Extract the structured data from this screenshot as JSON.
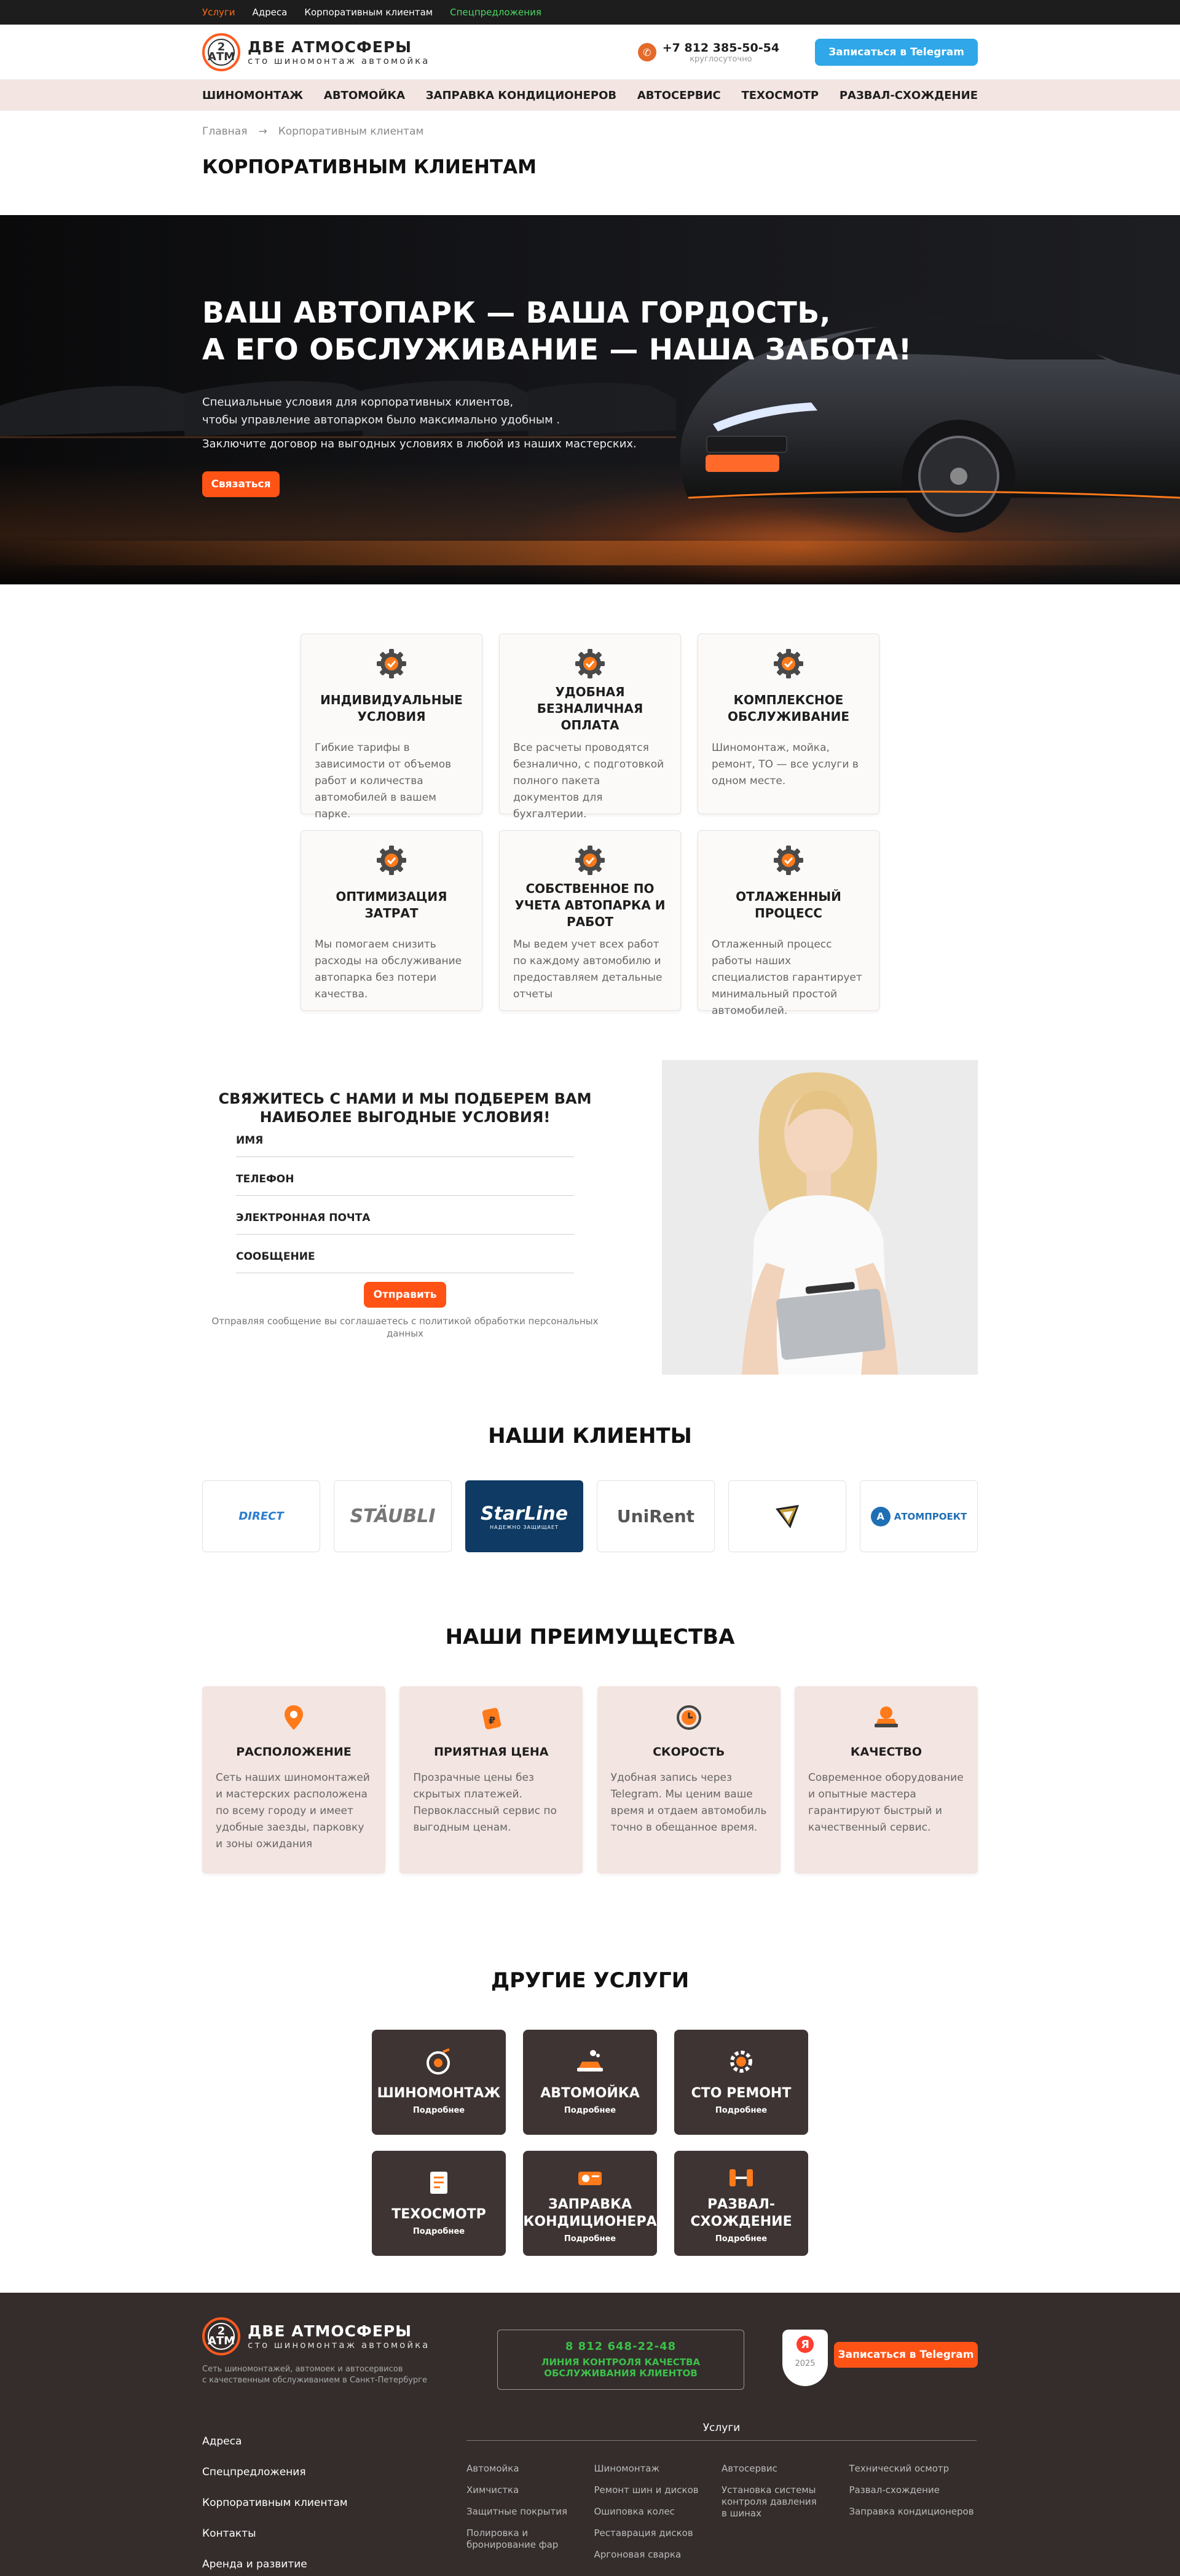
{
  "topbar": {
    "items": [
      "Услуги",
      "Адреса",
      "Корпоративным клиентам",
      "Спецпредложения"
    ]
  },
  "header": {
    "logo_badge": "2\nАТМ",
    "logo_title": "ДВЕ АТМОСФЕРЫ",
    "logo_subtitle": "сто шиномонтаж автомойка",
    "phone": "+7 812 385-50-54",
    "phone_note": "круглосуточно",
    "telegram_button": "Записаться в Telegram"
  },
  "nav": [
    "ШИНОМОНТАЖ",
    "АВТОМОЙКА",
    "ЗАПРАВКА КОНДИЦИОНЕРОВ",
    "АВТОСЕРВИС",
    "ТЕХОСМОТР",
    "РАЗВАЛ-СХОЖДЕНИЕ"
  ],
  "breadcrumb": {
    "home": "Главная",
    "sep": "→",
    "current": "Корпоративным клиентам"
  },
  "page_title": "КОРПОРАТИВНЫМ КЛИЕНТАМ",
  "hero": {
    "title_line1": "ВАШ АВТОПАРК — ВАША ГОРДОСТЬ,",
    "title_line2": "А ЕГО ОБСЛУЖИВАНИЕ — НАША ЗАБОТА!",
    "text_line1": "Специальные условия для корпоративных клиентов,",
    "text_line2": "чтобы управление автопарком было максимально удобным .",
    "text2": "Заключите договор на выгодных условиях в любой из наших мастерских.",
    "button": "Связаться"
  },
  "features": [
    {
      "title": "ИНДИВИДУАЛЬНЫЕ УСЛОВИЯ",
      "text": "Гибкие тарифы в зависимости от объемов работ и количества автомобилей в вашем парке."
    },
    {
      "title": "УДОБНАЯ БЕЗНАЛИЧНАЯ ОПЛАТА",
      "text": "Все расчеты проводятся безналично, с подготовкой полного пакета документов для бухгалтерии."
    },
    {
      "title": "КОМПЛЕКСНОЕ ОБСЛУЖИВАНИЕ",
      "text": "Шиномонтаж, мойка, ремонт, ТО — все услуги в одном месте."
    },
    {
      "title": "ОПТИМИЗАЦИЯ ЗАТРАТ",
      "text": "Мы помогаем снизить расходы на обслуживание автопарка без потери качества."
    },
    {
      "title": "СОБСТВЕННОЕ ПО УЧЕТА АВТОПАРКА И РАБОТ",
      "text": "Мы ведем учет всех работ по каждому автомобилю и предоставляем детальные отчеты"
    },
    {
      "title": "ОТЛАЖЕННЫЙ ПРОЦЕСС",
      "text": "Отлаженный процесс работы наших специалистов гарантирует минимальный простой автомобилей."
    }
  ],
  "contact": {
    "title_line1": "СВЯЖИТЕСЬ С НАМИ И МЫ ПОДБЕРЕМ ВАМ",
    "title_line2": "НАИБОЛЕЕ ВЫГОДНЫЕ УСЛОВИЯ!",
    "fields": [
      "ИМЯ",
      "ТЕЛЕФОН",
      "ЭЛЕКТРОННАЯ ПОЧТА",
      "СООБЩЕНИЕ"
    ],
    "button": "Отправить",
    "agree_line1": "Отправляя сообщение вы соглашаетесь с политикой обработки персональных",
    "agree_line2": "данных"
  },
  "clients": {
    "title": "НАШИ КЛИЕНТЫ",
    "logos": [
      "DIRECT",
      "STÄUBLI",
      "StarLine",
      "UniRent",
      "",
      "АТОМПРОЕКТ"
    ],
    "starline_sub": "НАДЕЖНО ЗАЩИЩАЕТ"
  },
  "advantages": {
    "title": "НАШИ ПРЕИМУЩЕСТВА",
    "items": [
      {
        "title": "РАСПОЛОЖЕНИЕ",
        "text": "Сеть наших шиномонтажей и мастерских расположена по всему городу и имеет удобные заезды, парковку и зоны ожидания",
        "icon": "location-pin-icon"
      },
      {
        "title": "ПРИЯТНАЯ ЦЕНА",
        "text": "Прозрачные цены без скрытых платежей. Первоклассный сервис по выгодным ценам.",
        "icon": "price-tag-icon"
      },
      {
        "title": "СКОРОСТЬ",
        "text": "Удобная запись через Telegram. Мы ценим ваше время и отдаем автомобиль точно в обещанное время.",
        "icon": "clock-icon"
      },
      {
        "title": "КАЧЕСТВО",
        "text": "Современное оборудование и опытные мастера гарантируют быстрый и качественный сервис.",
        "icon": "quality-car-icon"
      }
    ]
  },
  "services": {
    "title": "ДРУГИЕ УСЛУГИ",
    "more": "Подробнее",
    "items": [
      {
        "line1": "ШИНОМОНТАЖ",
        "line2": "",
        "icon": "tire-icon"
      },
      {
        "line1": "АВТОМОЙКА",
        "line2": "",
        "icon": "car-wash-icon"
      },
      {
        "line1": "СТО РЕМОНТ",
        "line2": "",
        "icon": "repair-gear-icon"
      },
      {
        "line1": "ТЕХОСМОТР",
        "line2": "",
        "icon": "checklist-icon"
      },
      {
        "line1": "ЗАПРАВКА",
        "line2": "КОНДИЦИОНЕРА",
        "icon": "aircon-icon"
      },
      {
        "line1": "РАЗВАЛ-",
        "line2": "СХОЖДЕНИЕ",
        "icon": "alignment-icon"
      }
    ]
  },
  "footer": {
    "desc_line1": "Сеть шиномонтажей, автомоек и автосервисов",
    "desc_line2": "с качественным обслуживанием в Санкт-Петербурге",
    "hotline_number": "8 812 648-22-48",
    "hotline_line1": "ЛИНИЯ КОНТРОЛЯ КАЧЕСТВА",
    "hotline_line2": "ОБСЛУЖИВАНИЯ КЛИЕНТОВ",
    "badge_letter": "Я",
    "badge_year": "2025",
    "telegram_button": "Записаться в Telegram",
    "links": [
      "Адреса",
      "Спецпредложения",
      "Корпоративным клиентам",
      "Контакты",
      "Аренда и развитие"
    ],
    "services_title": "Услуги",
    "services_cols": [
      [
        "Автомойка",
        "Химчистка",
        "Защитные покрытия",
        "Полировка и бронирование фар"
      ],
      [
        "Шиномонтаж",
        "Ремонт шин и дисков",
        "Ошиповка колес",
        "Реставрация дисков",
        "Аргоновая сварка"
      ],
      [
        "Автосервис",
        "Установка системы контроля давления в шинах"
      ],
      [
        "Технический осмотр",
        "Развал-схождение",
        "Заправка кондиционеров"
      ]
    ]
  },
  "colors": {
    "accent": "#ff5316",
    "telegram": "#2fa7e8",
    "nav_bg": "#f3e5e1",
    "footer_bg": "#342d2c",
    "hotline": "#3cc04a"
  }
}
